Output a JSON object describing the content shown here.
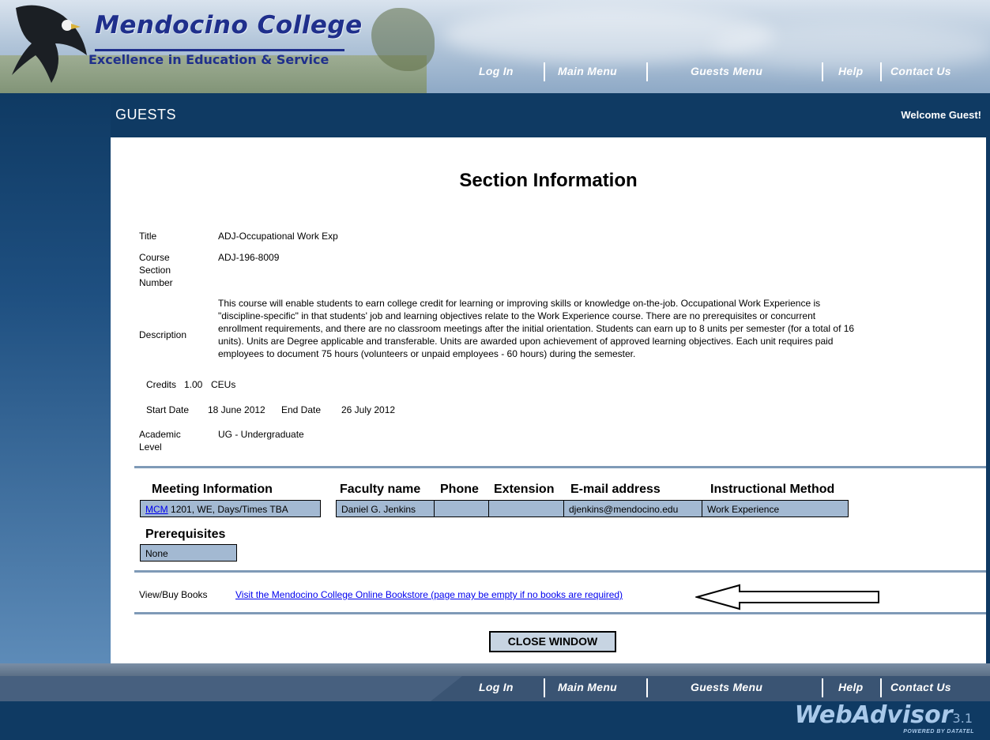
{
  "brand": {
    "name": "Mendocino College",
    "tagline": "Excellence in Education & Service"
  },
  "nav": {
    "log_in": "Log In",
    "main_menu": "Main Menu",
    "guests_menu": "Guests Menu",
    "help": "Help",
    "contact_us": "Contact Us"
  },
  "header": {
    "section": "Guests",
    "welcome": "Welcome Guest!"
  },
  "page": {
    "title": "Section Information"
  },
  "details": {
    "title_label": "Title",
    "title_value": "ADJ-Occupational Work Exp",
    "csn_label_1": "Course",
    "csn_label_2": "Section",
    "csn_label_3": "Number",
    "csn_value": "ADJ-196-8009",
    "description_label": "Description",
    "description_lines": [
      "This course will enable students to earn college credit for learning or improving skills or knowledge on-the-job. Occupational Work Experience is",
      "\"discipline-specific\" in that students' job and learning objectives relate to the Work Experience course. There are no prerequisites or concurrent",
      "enrollment requirements, and there are no classroom meetings after the initial orientation. Students can earn up to 8 units per semester (for a total of 16",
      "units). Units are Degree applicable and transferable. Units are awarded upon achievement of approved learning objectives. Each unit requires paid",
      "employees to document 75 hours (volunteers or unpaid employees - 60 hours) during the semester."
    ],
    "credits_label": "Credits",
    "credits_value": "1.00",
    "ceus_label": "CEUs",
    "start_date_label": "Start Date",
    "start_date_value": "18 June 2012",
    "end_date_label": "End Date",
    "end_date_value": "26 July 2012",
    "academic_label_1": "Academic",
    "academic_label_2": "Level",
    "academic_value": "UG - Undergraduate"
  },
  "meeting": {
    "headers": {
      "meeting_information": "Meeting Information",
      "faculty_name": "Faculty name",
      "phone": "Phone",
      "extension": "Extension",
      "email": "E-mail address",
      "method": "Instructional Method"
    },
    "location_link": "MCM",
    "location_rest": "1201, WE, Days/Times TBA",
    "faculty": "Daniel G. Jenkins",
    "phone": "",
    "extension": "",
    "email": "djenkins@mendocino.edu",
    "method": "Work Experience"
  },
  "prerequisites": {
    "label": "Prerequisites",
    "value": "None"
  },
  "books": {
    "label": "View/Buy Books",
    "link": "Visit the Mendocino College Online Bookstore (page may be empty if no books are required)"
  },
  "buttons": {
    "close": "CLOSE WINDOW"
  },
  "footer": {
    "logo": "WebAdvisor",
    "version": "3.1",
    "powered": "POWERED BY DATATEL"
  }
}
